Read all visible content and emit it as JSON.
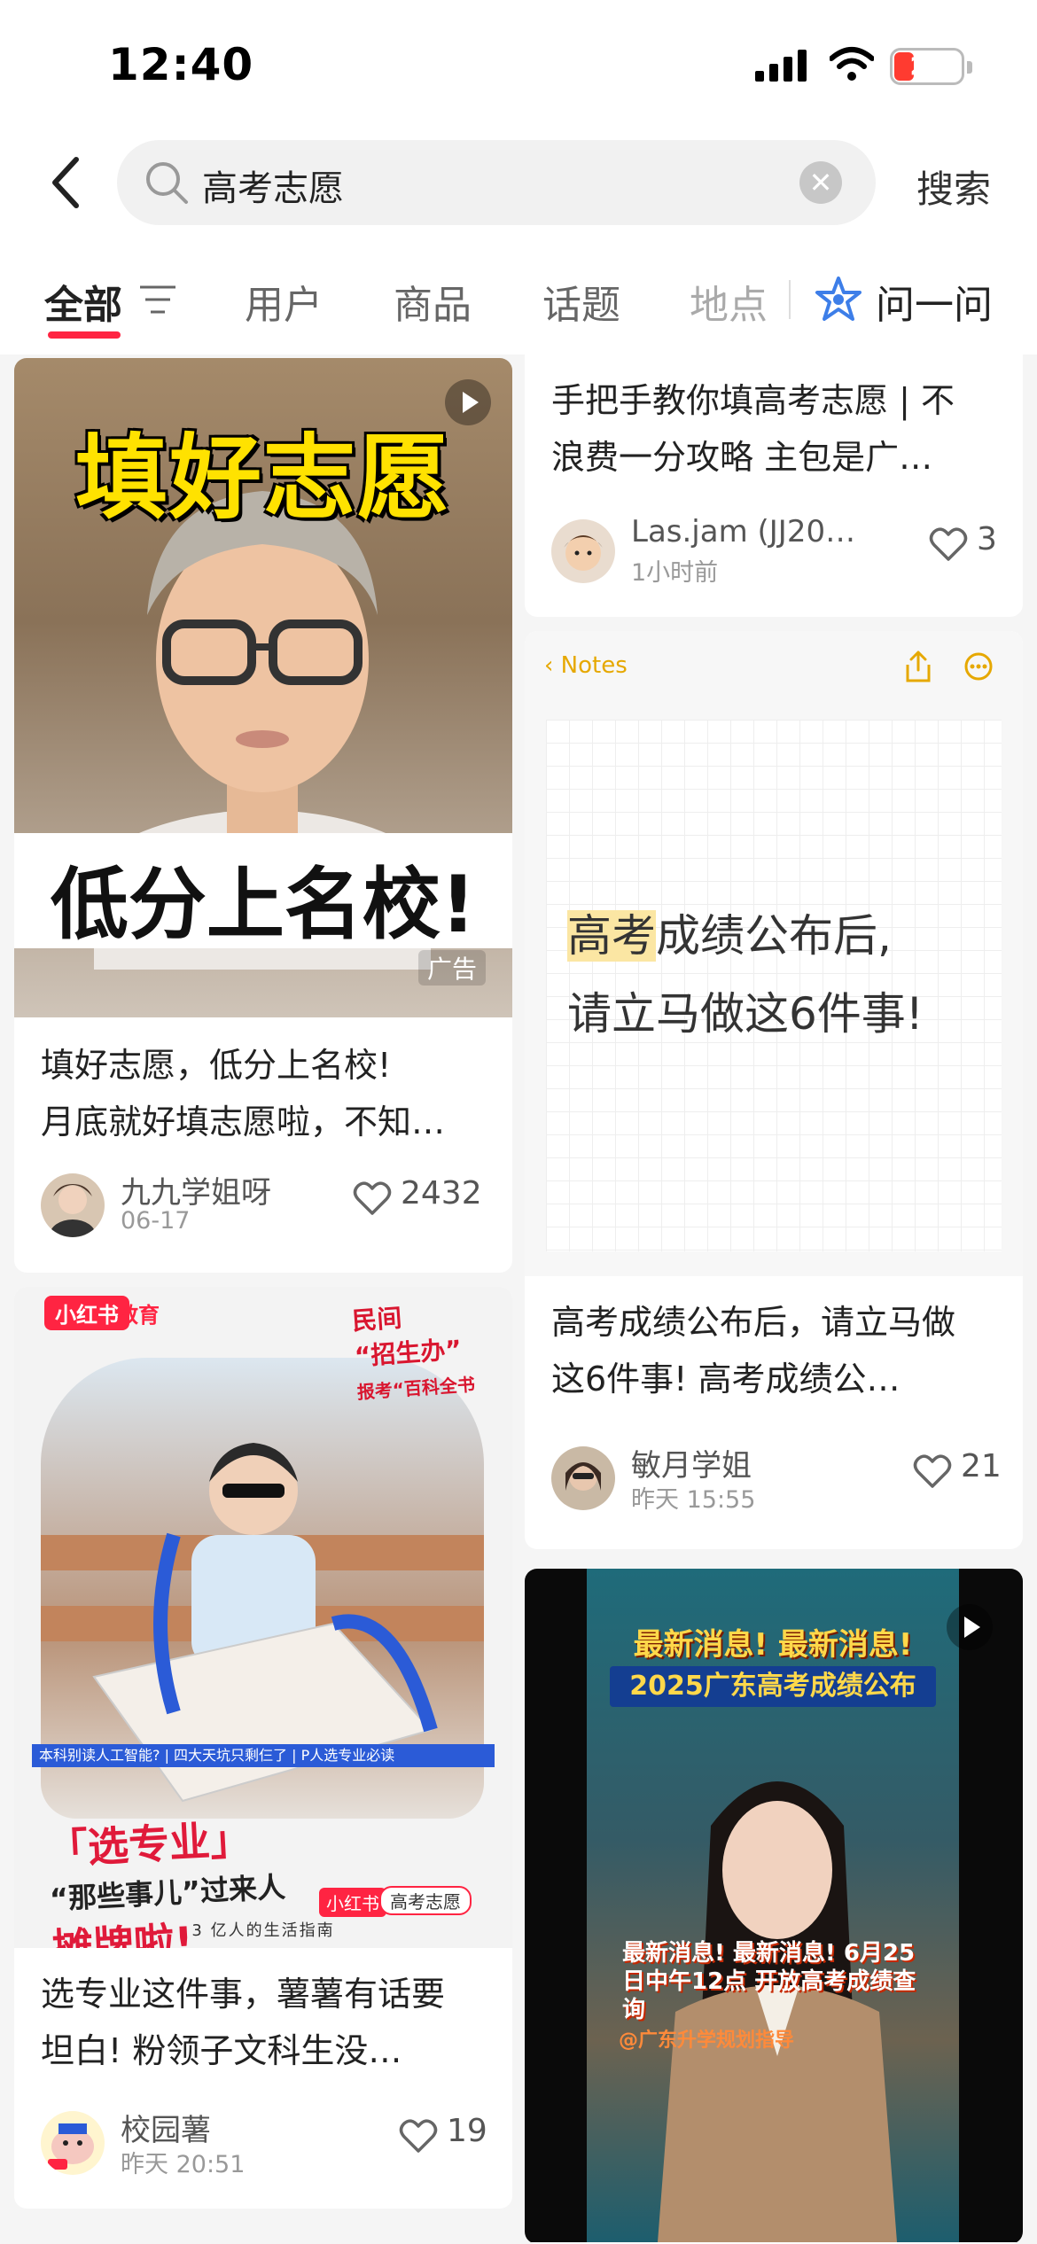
{
  "status": {
    "time": "12:40",
    "battery": "20"
  },
  "search": {
    "query": "高考志愿",
    "button_label": "搜索"
  },
  "tabs": [
    {
      "label": "全部"
    },
    {
      "label": "用户"
    },
    {
      "label": "商品"
    },
    {
      "label": "话题"
    },
    {
      "label": "地点"
    },
    {
      "label": "问一问"
    }
  ],
  "cards": {
    "c1": {
      "headline": "填好志愿",
      "banner": "低分上名校!",
      "ad_label": "广告",
      "title_line1": "填好志愿，低分上名校!",
      "title_line2": "月底就好填志愿啦，不知…",
      "author": "九九学姐呀",
      "time": "06-17",
      "likes": "2432"
    },
    "c2": {
      "title_line1": "手把手教你填高考志愿 | 不",
      "title_line2": "浪费一分攻略 主包是广…",
      "author": "Las.jam (JJ20…",
      "time": "1小时前",
      "likes": "3"
    },
    "c3": {
      "tag": "小红书",
      "tag2": "教育",
      "stamp_line1": "民间",
      "stamp_line2": "“招生办”",
      "stamp_line3": "报考“百科全书",
      "blue_strip": "本科别读人工智能? | 四大天坑只剩仨了 | P人选专业必读",
      "caption_line1": "「选专业」",
      "caption_line2": "“那些事儿”过来人",
      "caption_line3": "摊牌啦!",
      "footer": "3 亿人的生活指南",
      "foot_tag": "小红书",
      "foot_search": "高考志愿",
      "title_line1": "选专业这件事，薯薯有话要",
      "title_line2": "坦白!  粉领子文科生没…",
      "author": "校园薯",
      "time": "昨天 20:51",
      "likes": "19"
    },
    "c4": {
      "notes_back": "Notes",
      "highlight": "高考",
      "line1_rest": "成绩公布后,",
      "line2": "请立马做这6件事!",
      "title_line1": "高考成绩公布后，请立马做",
      "title_line2": "这6件事!  高考成绩公…",
      "author": "敏月学姐",
      "time": "昨天 15:55",
      "likes": "21"
    },
    "c6": {
      "head1": "最新消息! 最新消息!",
      "head2": "2025广东高考成绩公布",
      "sub": "最新消息! 最新消息! 6月25日中午12点 开放高考成绩查询",
      "sub2": "@广东升学规划指导"
    }
  },
  "colors": {
    "accent": "#ff2442",
    "brand_blue": "#3d7ee8"
  },
  "icons": [
    "signal-icon",
    "wifi-icon",
    "battery-icon",
    "back-icon",
    "search-icon",
    "clear-icon",
    "filter-icon",
    "ask-star-icon",
    "heart-icon",
    "play-icon",
    "share-icon",
    "more-icon"
  ]
}
